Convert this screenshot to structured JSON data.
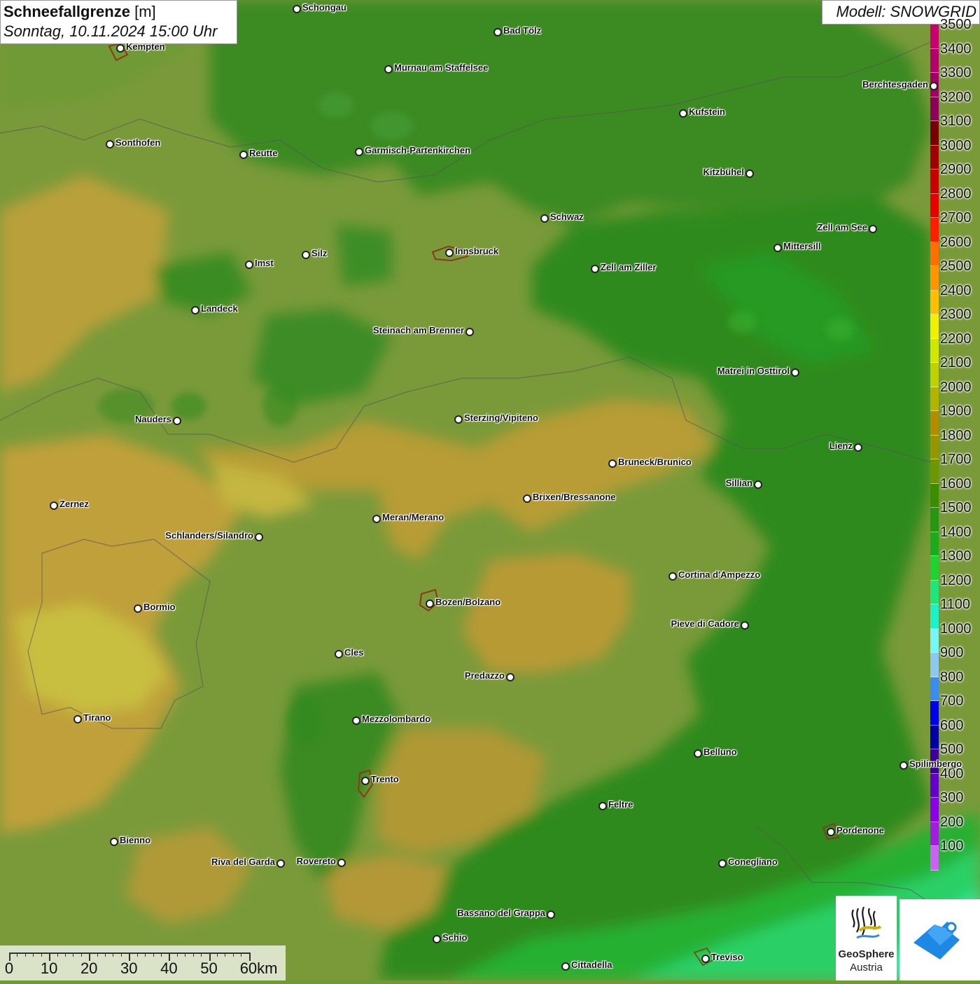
{
  "title": {
    "variable": "Schneefallgrenze",
    "unit": "[m]",
    "datetime": "Sonntag, 10.11.2024 15:00 Uhr"
  },
  "model_label": "Modell: SNOWGRID",
  "legend": {
    "unit": "m",
    "items": [
      {
        "value": "3500",
        "color": "#c8006e"
      },
      {
        "value": "3400",
        "color": "#b4006a"
      },
      {
        "value": "3300",
        "color": "#a00064"
      },
      {
        "value": "3200",
        "color": "#8c005a"
      },
      {
        "value": "3100",
        "color": "#780000"
      },
      {
        "value": "3000",
        "color": "#a00000"
      },
      {
        "value": "2900",
        "color": "#c80000"
      },
      {
        "value": "2800",
        "color": "#e60000"
      },
      {
        "value": "2700",
        "color": "#ff1e00"
      },
      {
        "value": "2600",
        "color": "#ff6e00"
      },
      {
        "value": "2500",
        "color": "#ff9600"
      },
      {
        "value": "2400",
        "color": "#ffbe00"
      },
      {
        "value": "2300",
        "color": "#f0f000"
      },
      {
        "value": "2200",
        "color": "#d2e600"
      },
      {
        "value": "2100",
        "color": "#bed200"
      },
      {
        "value": "2000",
        "color": "#b4b400"
      },
      {
        "value": "1900",
        "color": "#b48c00"
      },
      {
        "value": "1800",
        "color": "#969600"
      },
      {
        "value": "1700",
        "color": "#6e9600"
      },
      {
        "value": "1600",
        "color": "#3c8c00"
      },
      {
        "value": "1500",
        "color": "#289614"
      },
      {
        "value": "1400",
        "color": "#1eaa1e"
      },
      {
        "value": "1300",
        "color": "#1ed232"
      },
      {
        "value": "1200",
        "color": "#1ee678"
      },
      {
        "value": "1100",
        "color": "#1ef0c8"
      },
      {
        "value": "1000",
        "color": "#78f5f5"
      },
      {
        "value": "900",
        "color": "#8cc8f0"
      },
      {
        "value": "800",
        "color": "#3c8cf0"
      },
      {
        "value": "700",
        "color": "#0000e6"
      },
      {
        "value": "600",
        "color": "#0000a0"
      },
      {
        "value": "500",
        "color": "#3c0096"
      },
      {
        "value": "400",
        "color": "#6400c8"
      },
      {
        "value": "300",
        "color": "#8c00e6"
      },
      {
        "value": "200",
        "color": "#a01edc"
      },
      {
        "value": "100",
        "color": "#c864f0"
      }
    ]
  },
  "cities": [
    {
      "name": "Schongau",
      "side": "right"
    },
    {
      "name": "Bad Tölz",
      "side": "right"
    },
    {
      "name": "Kempten",
      "side": "right"
    },
    {
      "name": "Murnau am Staffelsee",
      "side": "right"
    },
    {
      "name": "Berchtesgaden",
      "side": "left"
    },
    {
      "name": "Kufstein",
      "side": "right"
    },
    {
      "name": "Sonthofen",
      "side": "right"
    },
    {
      "name": "Reutte",
      "side": "right"
    },
    {
      "name": "Garmisch-Partenkirchen",
      "side": "right"
    },
    {
      "name": "Kitzbühel",
      "side": "left"
    },
    {
      "name": "Schwaz",
      "side": "right"
    },
    {
      "name": "Zell am See",
      "side": "left"
    },
    {
      "name": "Mittersill",
      "side": "right"
    },
    {
      "name": "Innsbruck",
      "side": "right"
    },
    {
      "name": "Silz",
      "side": "right"
    },
    {
      "name": "Imst",
      "side": "right"
    },
    {
      "name": "Zell am Ziller",
      "side": "right"
    },
    {
      "name": "Landeck",
      "side": "right"
    },
    {
      "name": "Steinach am Brenner",
      "side": "left"
    },
    {
      "name": "Matrei in Osttirol",
      "side": "left"
    },
    {
      "name": "Nauders",
      "side": "left"
    },
    {
      "name": "Sterzing/Vipiteno",
      "side": "right"
    },
    {
      "name": "Lienz",
      "side": "left"
    },
    {
      "name": "Bruneck/Brunico",
      "side": "right"
    },
    {
      "name": "Sillian",
      "side": "left"
    },
    {
      "name": "Zernez",
      "side": "right"
    },
    {
      "name": "Brixen/Bressanone",
      "side": "right"
    },
    {
      "name": "Meran/Merano",
      "side": "right"
    },
    {
      "name": "Schlanders/Silandro",
      "side": "left"
    },
    {
      "name": "Cortina d'Ampezzo",
      "side": "right"
    },
    {
      "name": "Bozen/Bolzano",
      "side": "right"
    },
    {
      "name": "Bormio",
      "side": "right"
    },
    {
      "name": "Pieve di Cadore",
      "side": "left"
    },
    {
      "name": "Cles",
      "side": "right"
    },
    {
      "name": "Predazzo",
      "side": "left"
    },
    {
      "name": "Tirano",
      "side": "right"
    },
    {
      "name": "Mezzolombardo",
      "side": "right"
    },
    {
      "name": "Belluno",
      "side": "right"
    },
    {
      "name": "Spilimbergo",
      "side": "right"
    },
    {
      "name": "Trento",
      "side": "right"
    },
    {
      "name": "Feltre",
      "side": "right"
    },
    {
      "name": "Pordenone",
      "side": "right"
    },
    {
      "name": "Bienno",
      "side": "right"
    },
    {
      "name": "Riva del Garda",
      "side": "left"
    },
    {
      "name": "Rovereto",
      "side": "left"
    },
    {
      "name": "Conegliano",
      "side": "right"
    },
    {
      "name": "Bassano del Grappa",
      "side": "left"
    },
    {
      "name": "Schio",
      "side": "right"
    },
    {
      "name": "Treviso",
      "side": "right"
    },
    {
      "name": "Cittadella",
      "side": "right"
    }
  ],
  "scalebar": {
    "labels": [
      "0",
      "10",
      "20",
      "30",
      "40",
      "50",
      "60km"
    ]
  },
  "logos": {
    "agency_name": "GeoSphere",
    "agency_sub": "Austria",
    "app_icon": "weather-app-icon",
    "agency_icon": "geosphere-logo-icon"
  }
}
